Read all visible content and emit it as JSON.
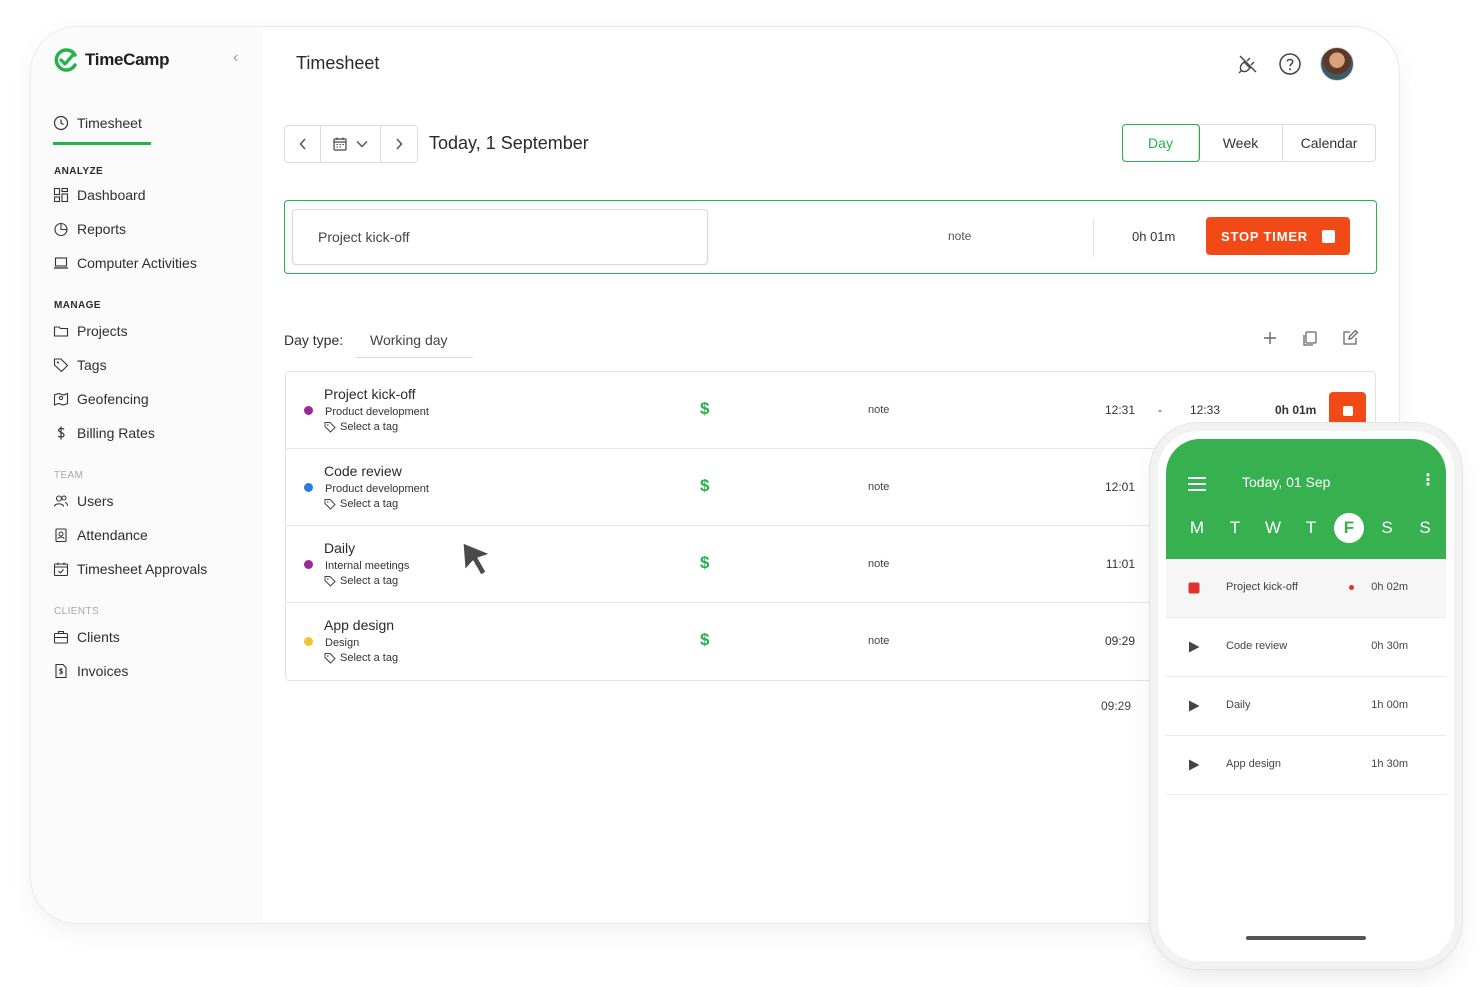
{
  "brand": {
    "name": "TimeCamp",
    "accent": "#25b14c",
    "danger": "#f24a17"
  },
  "sidebar": {
    "active": {
      "label": "Timesheet",
      "icon": "clock-icon"
    },
    "sections": [
      {
        "title": "ANALYZE",
        "items": [
          {
            "label": "Dashboard",
            "icon": "dashboard-icon"
          },
          {
            "label": "Reports",
            "icon": "reports-icon"
          },
          {
            "label": "Computer Activities",
            "icon": "laptop-icon"
          }
        ]
      },
      {
        "title": "MANAGE",
        "items": [
          {
            "label": "Projects",
            "icon": "folder-icon"
          },
          {
            "label": "Tags",
            "icon": "tag-icon"
          },
          {
            "label": "Geofencing",
            "icon": "map-icon"
          },
          {
            "label": "Billing Rates",
            "icon": "dollar-icon"
          }
        ]
      },
      {
        "title": "TEAM",
        "items": [
          {
            "label": "Users",
            "icon": "users-icon"
          },
          {
            "label": "Attendance",
            "icon": "badge-icon"
          },
          {
            "label": "Timesheet Approvals",
            "icon": "calendar-check-icon"
          }
        ]
      },
      {
        "title": "CLIENTS",
        "items": [
          {
            "label": "Clients",
            "icon": "briefcase-icon"
          },
          {
            "label": "Invoices",
            "icon": "invoice-icon"
          }
        ]
      }
    ]
  },
  "header": {
    "title": "Timesheet"
  },
  "date_nav": {
    "label": "Today, 1 September"
  },
  "views": [
    "Day",
    "Week",
    "Calendar"
  ],
  "timer": {
    "task": "Project kick-off",
    "note": "note",
    "duration": "0h 01m",
    "stop_label": "STOP TIMER"
  },
  "day_type": {
    "label": "Day type:",
    "value": "Working day"
  },
  "entries": [
    {
      "title": "Project kick-off",
      "project": "Product development",
      "tag": "Select a tag",
      "billing": "$",
      "note": "note",
      "start": "12:31",
      "dash": "-",
      "end": "12:33",
      "duration": "0h 01m",
      "dot": "#9b2a8f"
    },
    {
      "title": "Code review",
      "project": "Product development",
      "tag": "Select a tag",
      "billing": "$",
      "note": "note",
      "start": "12:01",
      "dot": "#2b7de1"
    },
    {
      "title": "Daily",
      "project": "Internal meetings",
      "tag": "Select a tag",
      "billing": "$",
      "note": "note",
      "start": "11:01",
      "dot": "#9b2a8f"
    },
    {
      "title": "App design",
      "project": "Design",
      "tag": "Select a tag",
      "billing": "$",
      "note": "note",
      "start": "09:29",
      "dot": "#f2c23a"
    }
  ],
  "total": "09:29",
  "phone": {
    "title": "Today, 01 Sep",
    "weekdays": [
      "M",
      "T",
      "W",
      "T",
      "F",
      "S",
      "S"
    ],
    "selected_day": 4,
    "items": [
      {
        "name": "Project kick-off",
        "time": "0h 02m",
        "recording": true
      },
      {
        "name": "Code review",
        "time": "0h 30m"
      },
      {
        "name": "Daily",
        "time": "1h 00m"
      },
      {
        "name": "App design",
        "time": "1h 30m"
      }
    ]
  }
}
